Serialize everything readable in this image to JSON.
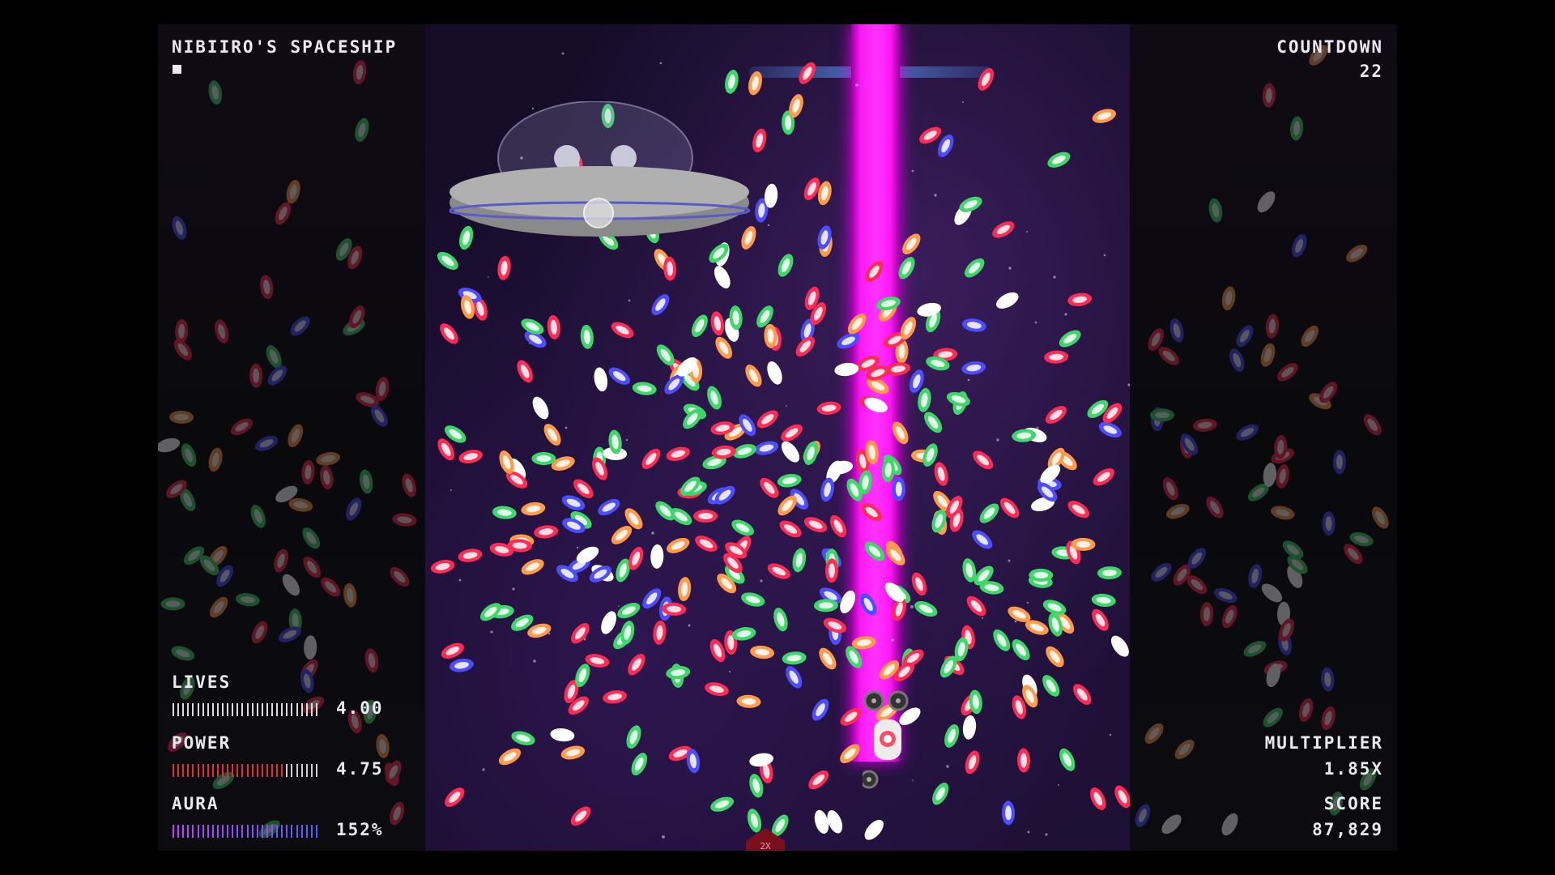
{
  "hud": {
    "stage_name": "NIBIIRO'S SPACESHIP",
    "countdown_label": "COUNTDOWN",
    "countdown_value": "22",
    "lives_label": "LIVES",
    "lives_value": "4.00",
    "lives_fill": 1.0,
    "power_label": "POWER",
    "power_value": "4.75",
    "power_fill": 0.75,
    "aura_label": "AURA",
    "aura_value": "152%",
    "aura_fill": 1.0,
    "multiplier_label": "MULTIPLIER",
    "multiplier_value": "1.85X",
    "score_label": "SCORE",
    "score_value": "87,829",
    "bonus_marker_text": "2X"
  },
  "colors": {
    "laser": "#ff19f5",
    "bullet_green": "#3fd66a",
    "bullet_red": "#ff2b55",
    "bullet_orange": "#ff9a4a",
    "bullet_blue": "#4d4dff",
    "bullet_white": "#ffffff",
    "lives_meter": "#dcdcdc",
    "power_meter": "#e0303c",
    "aura_meter_start": "#c040ff",
    "aura_meter_end": "#5060ff"
  },
  "icons": {
    "boss": "ufo-icon",
    "player": "player-ship-icon",
    "option_drone": "drone-icon",
    "bullet": "bullet-icon"
  }
}
